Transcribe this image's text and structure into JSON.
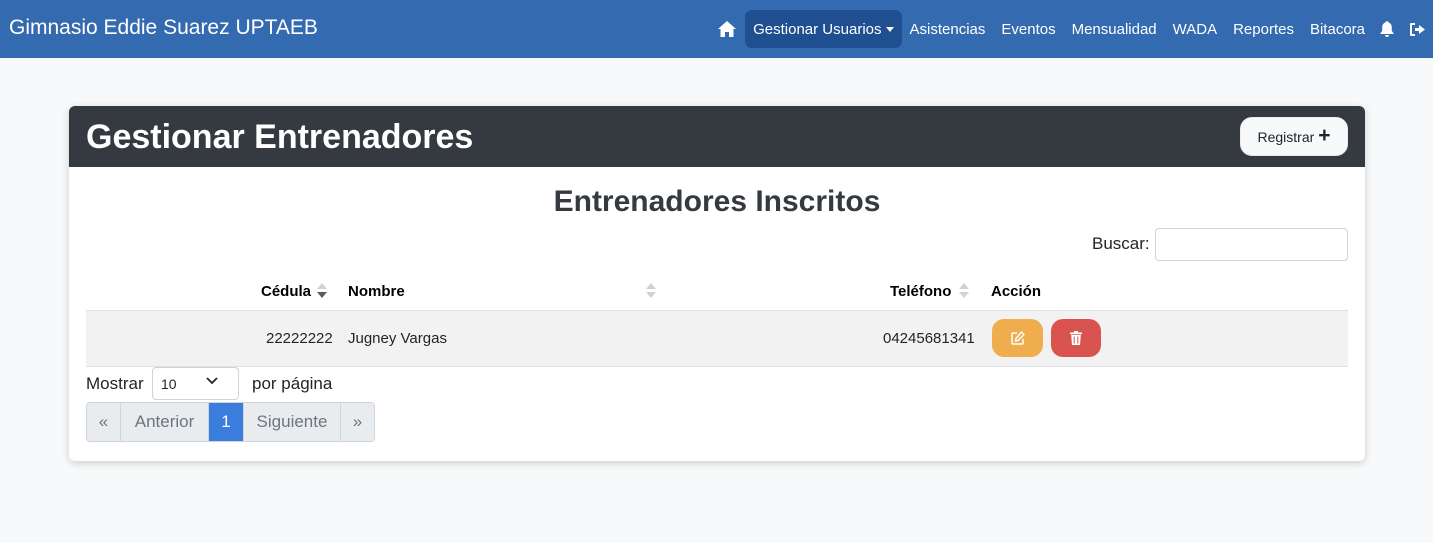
{
  "navbar": {
    "brand": "Gimnasio Eddie Suarez UPTAEB",
    "items": [
      {
        "label": "Gestionar Usuarios"
      },
      {
        "label": "Asistencias"
      },
      {
        "label": "Eventos"
      },
      {
        "label": "Mensualidad"
      },
      {
        "label": "WADA"
      },
      {
        "label": "Reportes"
      },
      {
        "label": "Bitacora"
      }
    ],
    "icons": [
      "home-icon",
      "bell-icon",
      "logout-icon"
    ]
  },
  "card": {
    "title": "Gestionar Entrenadores",
    "register_label": "Registrar",
    "register_icon": "plus-icon",
    "subtitle": "Entrenadores Inscritos"
  },
  "search": {
    "label": "Buscar:",
    "value": "",
    "placeholder": ""
  },
  "table": {
    "columns": [
      "Cédula",
      "Nombre",
      "Teléfono",
      "Acción"
    ],
    "rows": [
      {
        "cedula": "22222222",
        "nombre": "Jugney Vargas",
        "telefono": "04245681341"
      }
    ]
  },
  "paging": {
    "show_label": "Mostrar",
    "per_page_value": "10",
    "per_page_suffix": "por página",
    "first": "«",
    "prev": "Anterior",
    "current": "1",
    "next": "Siguiente",
    "last": "»"
  },
  "colors": {
    "navbar": "#346aaf",
    "nav_active": "#1f4e91",
    "card_header": "#343a40",
    "edit_button": "#f0ad4e",
    "delete_button": "#d9534f",
    "page_active": "#3b7ddd"
  }
}
